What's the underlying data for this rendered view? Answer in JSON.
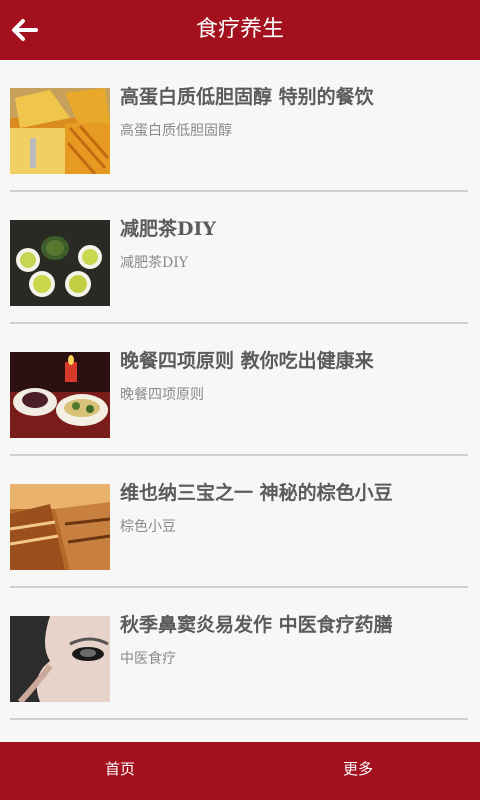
{
  "header": {
    "title": "食疗养生",
    "back_icon": "back-arrow-icon"
  },
  "articles": [
    {
      "title": "高蛋白质低胆固醇 特别的餐饮",
      "subtitle": "高蛋白质低胆固醇",
      "image": "cheese-plate-image"
    },
    {
      "title": "减肥茶DIY",
      "subtitle": "减肥茶DIY",
      "image": "green-tea-cups-image"
    },
    {
      "title": "晚餐四项原则 教你吃出健康来",
      "subtitle": "晚餐四项原则",
      "image": "dinner-table-image"
    },
    {
      "title": "维也纳三宝之一 神秘的棕色小豆",
      "subtitle": "棕色小豆",
      "image": "chocolate-pastry-image"
    },
    {
      "title": "秋季鼻窦炎易发作 中医食疗药膳",
      "subtitle": "中医食疗",
      "image": "face-closeup-image"
    }
  ],
  "footer": {
    "home_label": "首页",
    "more_label": "更多"
  },
  "colors": {
    "primary": "#a3101e",
    "background": "#f7f7f7",
    "divider": "#cfcfcf"
  }
}
